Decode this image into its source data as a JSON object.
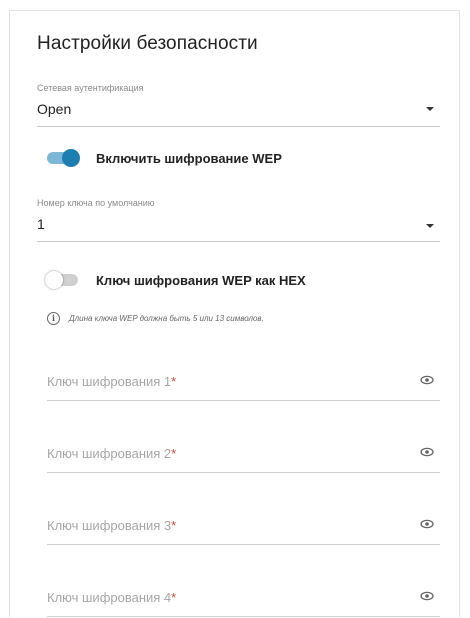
{
  "title": "Настройки безопасности",
  "auth": {
    "label": "Сетевая аутентификация",
    "value": "Open"
  },
  "wep_toggle": {
    "label": "Включить шифрование WEP",
    "enabled": true
  },
  "default_key": {
    "label": "Номер ключа по умолчанию",
    "value": "1"
  },
  "hex_toggle": {
    "label": "Ключ шифрования WEP как HEX",
    "enabled": false
  },
  "info": {
    "icon": "info-icon",
    "text": "Длина ключа WEP должна быть 5 или 13 символов."
  },
  "keys": [
    {
      "placeholder": "Ключ шифрования 1",
      "required": "*"
    },
    {
      "placeholder": "Ключ шифрования 2",
      "required": "*"
    },
    {
      "placeholder": "Ключ шифрования 3",
      "required": "*"
    },
    {
      "placeholder": "Ключ шифрования 4",
      "required": "*"
    }
  ],
  "colors": {
    "accent": "#1d7fb1",
    "required": "#d0453f"
  }
}
